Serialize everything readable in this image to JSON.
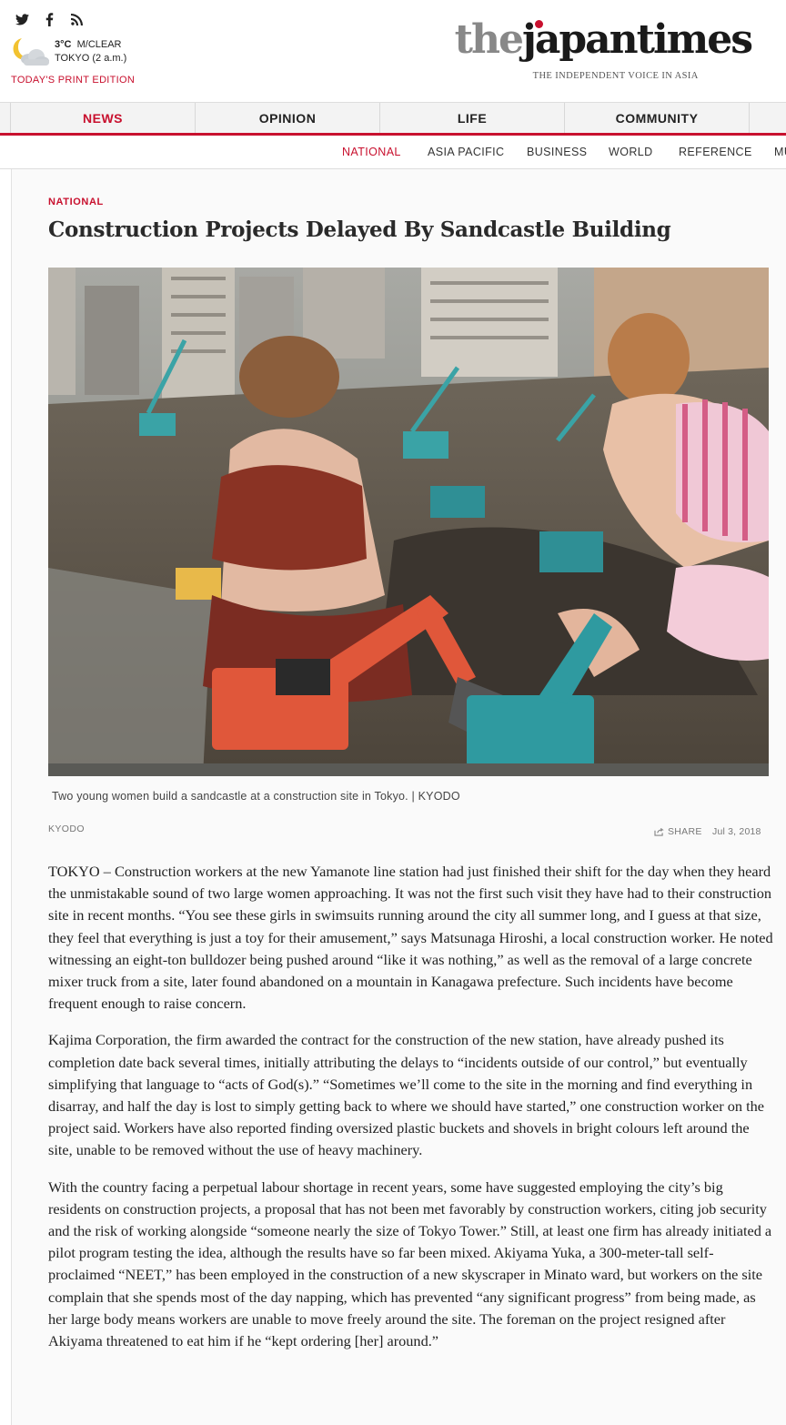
{
  "header": {
    "social": [
      {
        "name": "twitter-icon",
        "glyph": "𝕏"
      },
      {
        "name": "facebook-icon",
        "glyph": "f"
      },
      {
        "name": "rss-icon",
        "glyph": "⟟"
      }
    ],
    "weather": {
      "temp": "3°C",
      "condition": "M/CLEAR",
      "location": "TOKYO (2 a.m.)",
      "icon": "moon-cloud-icon"
    },
    "print_edition": "TODAY'S PRINT EDITION",
    "logo_the": "the",
    "logo_rest": "japantimes",
    "tagline": "THE INDEPENDENT VOICE IN ASIA"
  },
  "nav": {
    "tabs": [
      "NEWS",
      "OPINION",
      "LIFE",
      "COMMUNITY"
    ],
    "active_tab": "NEWS",
    "sub": [
      "NATIONAL",
      "ASIA PACIFIC",
      "BUSINESS",
      "WORLD",
      "REFERENCE",
      "MU"
    ],
    "active_sub": "NATIONAL"
  },
  "article": {
    "category": "NATIONAL",
    "headline": "Construction Projects Delayed By Sandcastle Building",
    "caption": "Two young women build a sandcastle at a construction site in Tokyo. | KYODO",
    "byline": "KYODO",
    "share_label": "SHARE",
    "date": "Jul 3, 2018",
    "paragraphs": [
      "TOKYO – Construction workers at the new Yamanote line station had just finished their shift for the day when they heard the unmistakable sound of two large women approaching. It was not the first such visit they have had to their construction site in recent months. “You see these girls in swimsuits running around the city all summer long, and I guess at that size, they feel that everything is just a toy for their amusement,” says Matsunaga Hiroshi, a local construction worker. He noted witnessing an eight-ton bulldozer being pushed around “like it was nothing,” as well as the removal of a large concrete mixer truck from a site, later found abandoned on a mountain in Kanagawa prefecture. Such incidents have become frequent enough to raise concern.",
      "Kajima Corporation, the firm awarded the contract for the construction of the new station, have already pushed its completion date back several times, initially attributing the delays to “incidents outside of our control,” but eventually simplifying that language to “acts of God(s).” “Sometimes we’ll come to the site in the morning and find everything in disarray, and half the day is lost to simply getting back to where we should have started,” one construction worker on the project said. Workers have also reported finding oversized plastic buckets and shovels in bright colours left around the site, unable to be removed without the use of heavy machinery.",
      "With the country facing a perpetual labour shortage in recent years, some have suggested employing the city’s big residents on construction projects, a proposal that has not been met favorably by construction workers, citing job security and the risk of working alongside “someone nearly the size of Tokyo Tower.” Still, at least one firm has already initiated a pilot program testing the idea, although the results have so far been mixed. Akiyama Yuka, a 300-meter-tall self-proclaimed “NEET,” has been employed in the construction of a new skyscraper in Minato ward, but workers on the site complain that she spends most of the day napping, which has prevented “any significant progress” from being made, as her large body means workers are unable to move freely around the site. The foreman on the project resigned after Akiyama threatened to eat him if he “kept ordering [her] around.”"
    ]
  },
  "colors": {
    "accent": "#c8102e",
    "nav_bg": "#f3f3f3",
    "article_bg": "#fafafa"
  }
}
